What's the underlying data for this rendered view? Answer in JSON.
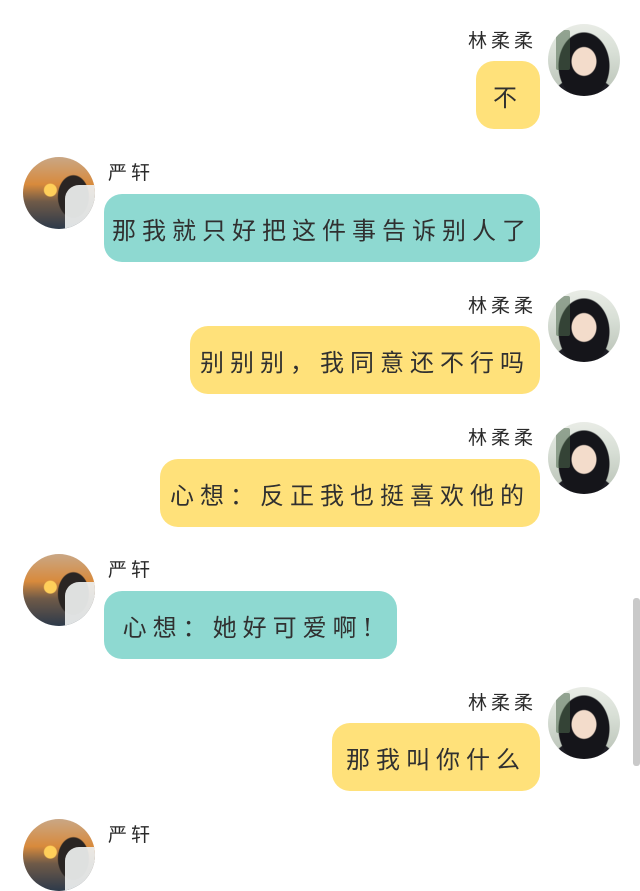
{
  "chat": {
    "messages": [
      {
        "sender": "林柔柔",
        "side": "right",
        "text": "不",
        "avatar": "girl-avatar"
      },
      {
        "sender": "严轩",
        "side": "left",
        "text": "那我就只好把这件事告诉别人了",
        "avatar": "boy-avatar"
      },
      {
        "sender": "林柔柔",
        "side": "right",
        "text": "别别别，我同意还不行吗",
        "avatar": "girl-avatar"
      },
      {
        "sender": "林柔柔",
        "side": "right",
        "text": "心想：反正我也挺喜欢他的",
        "avatar": "girl-avatar"
      },
      {
        "sender": "严轩",
        "side": "left",
        "text": "心想：她好可爱啊!",
        "avatar": "boy-avatar"
      },
      {
        "sender": "林柔柔",
        "side": "right",
        "text": "那我叫你什么",
        "avatar": "girl-avatar"
      },
      {
        "sender": "严轩",
        "side": "left",
        "text": "",
        "avatar": "boy-avatar"
      }
    ]
  },
  "colors": {
    "right_bubble": "#ffe17a",
    "left_bubble": "#8ed9d1",
    "background": "#ffffff"
  }
}
